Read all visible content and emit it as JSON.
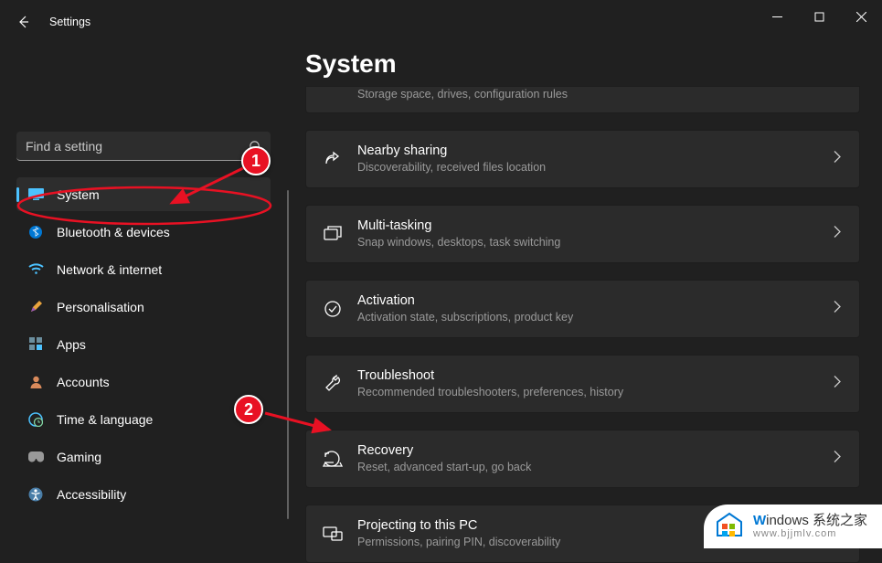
{
  "app_title": "Settings",
  "page_title": "System",
  "search": {
    "placeholder": "Find a setting"
  },
  "sidebar": {
    "items": [
      {
        "label": "System",
        "active": true
      },
      {
        "label": "Bluetooth & devices"
      },
      {
        "label": "Network & internet"
      },
      {
        "label": "Personalisation"
      },
      {
        "label": "Apps"
      },
      {
        "label": "Accounts"
      },
      {
        "label": "Time & language"
      },
      {
        "label": "Gaming"
      },
      {
        "label": "Accessibility"
      }
    ]
  },
  "cards": [
    {
      "title": "",
      "desc": "Storage space, drives, configuration rules",
      "fragment": true
    },
    {
      "title": "Nearby sharing",
      "desc": "Discoverability, received files location"
    },
    {
      "title": "Multi-tasking",
      "desc": "Snap windows, desktops, task switching"
    },
    {
      "title": "Activation",
      "desc": "Activation state, subscriptions, product key"
    },
    {
      "title": "Troubleshoot",
      "desc": "Recommended troubleshooters, preferences, history"
    },
    {
      "title": "Recovery",
      "desc": "Reset, advanced start-up, go back"
    },
    {
      "title": "Projecting to this PC",
      "desc": "Permissions, pairing PIN, discoverability"
    }
  ],
  "annotations": {
    "marker1": "1",
    "marker2": "2"
  },
  "watermark": {
    "brand_prefix": "W",
    "brand_rest": "indows",
    "brand_suffix": " 系统之家",
    "url": "www.bjjmlv.com"
  }
}
